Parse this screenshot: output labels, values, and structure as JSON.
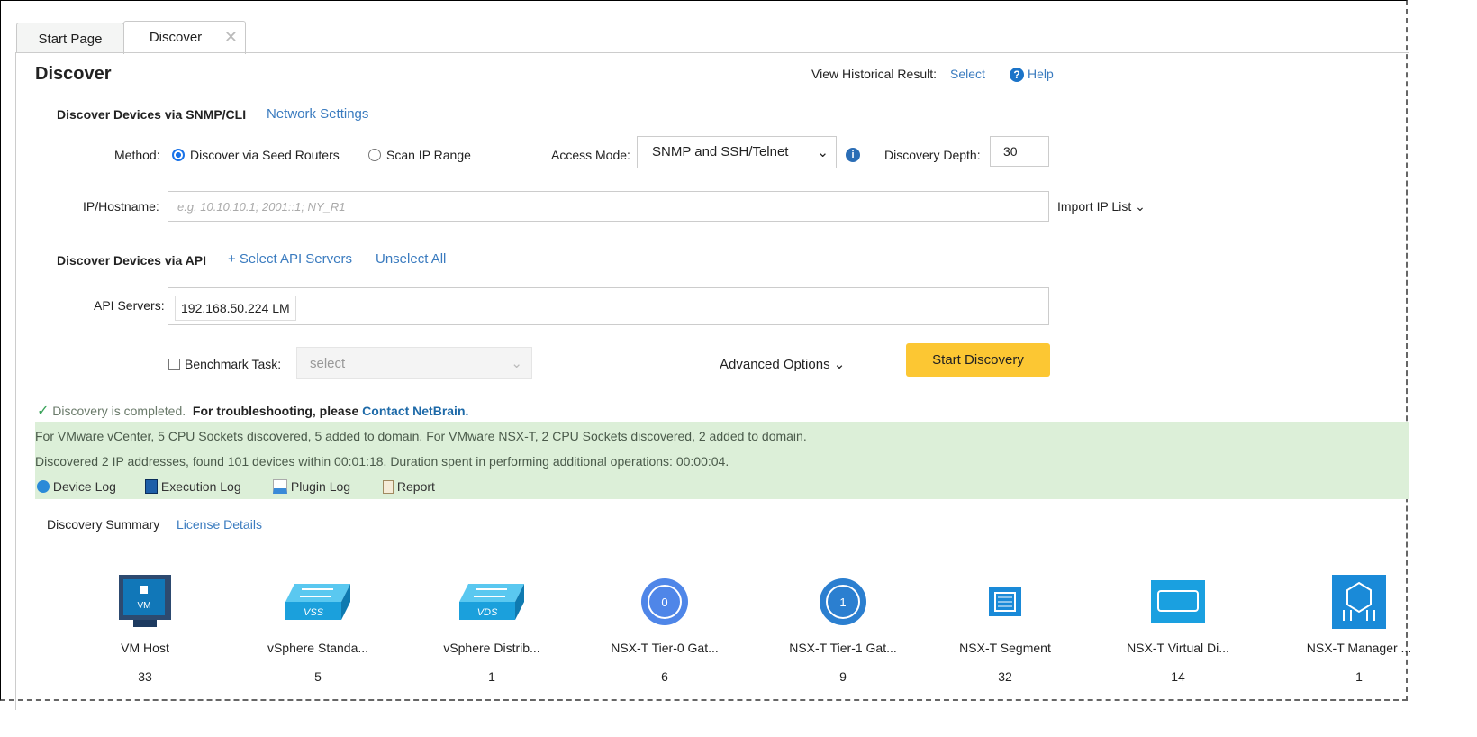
{
  "tabs": [
    {
      "label": "Start Page"
    },
    {
      "label": "Discover"
    }
  ],
  "page_title": "Discover",
  "header": {
    "historical_label": "View Historical Result:",
    "select_link": "Select",
    "help": "Help"
  },
  "snmp": {
    "title": "Discover Devices via SNMP/CLI",
    "network_settings": "Network Settings",
    "method_label": "Method:",
    "method_options": [
      "Discover via Seed Routers",
      "Scan IP Range"
    ],
    "method_selected": "Discover via Seed Routers",
    "access_mode_label": "Access Mode:",
    "access_mode_value": "SNMP and SSH/Telnet",
    "depth_label": "Discovery Depth:",
    "depth_value": "30",
    "ip_label": "IP/Hostname:",
    "ip_placeholder": "e.g. 10.10.10.1; 2001::1; NY_R1",
    "import_ip": "Import IP List"
  },
  "api": {
    "title": "Discover Devices via API",
    "select_servers": "+ Select API Servers",
    "unselect_all": "Unselect All",
    "servers_label": "API Servers:",
    "server_tag": "192.168.50.224 LM"
  },
  "benchmark": {
    "label": "Benchmark Task:",
    "placeholder": "select",
    "checked": false
  },
  "advanced": "Advanced Options",
  "start_button": "Start Discovery",
  "status": {
    "completed": "Discovery is completed.",
    "troubleshoot": "For troubleshooting, please",
    "contact": "Contact NetBrain."
  },
  "result": {
    "line1": "For VMware vCenter, 5 CPU Sockets discovered, 5 added to domain. For VMware NSX-T, 2 CPU Sockets discovered, 2 added to domain.",
    "line2": "Discovered 2 IP addresses, found 101 devices within 00:01:18.  Duration spent in performing additional operations: 00:00:04.",
    "logs": [
      "Device Log",
      "Execution Log",
      "Plugin Log",
      "Report"
    ]
  },
  "summary": {
    "title": "Discovery Summary",
    "license": "License Details",
    "items": [
      {
        "label": "VM Host",
        "count": "33"
      },
      {
        "label": "vSphere Standa...",
        "count": "5"
      },
      {
        "label": "vSphere Distrib...",
        "count": "1"
      },
      {
        "label": "NSX-T Tier-0 Gat...",
        "count": "6"
      },
      {
        "label": "NSX-T Tier-1 Gat...",
        "count": "9"
      },
      {
        "label": "NSX-T Segment",
        "count": "32"
      },
      {
        "label": "NSX-T Virtual Di...",
        "count": "14"
      },
      {
        "label": "NSX-T Manager ...",
        "count": "1"
      }
    ]
  }
}
